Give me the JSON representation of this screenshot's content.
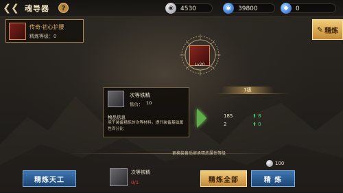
{
  "header": {
    "back_icon": "back-arrow-icon",
    "title": "魂导器",
    "help": "?"
  },
  "resources": {
    "silver": {
      "icon": "silver-coin-icon",
      "value": "4530"
    },
    "gold": {
      "icon": "gold-coin-icon",
      "value": "39800"
    },
    "diamond": {
      "icon": "diamond-icon",
      "value": "0"
    }
  },
  "tab": {
    "label": "精炼",
    "icon": "hammer-icon"
  },
  "equipment": {
    "name": "传奇·初心护腰",
    "refine_level": "精炼等级：0"
  },
  "center_item": {
    "level": "Lv20"
  },
  "level_banner": "1级",
  "stats": {
    "row1": {
      "value": "185",
      "increase": "8"
    },
    "row2": {
      "value": "2",
      "increase": "0"
    }
  },
  "tooltip": {
    "name": "次等铁精",
    "price_label": "售价：",
    "price_value": "10",
    "info_title": "物品信息",
    "description": "用于装备精炼的次等材料，提升装备基础属性百分比"
  },
  "hint": "更换装备后继承精炼属性等级",
  "material": {
    "name": "次等铁精",
    "count": "0/1"
  },
  "cost": {
    "value": "100"
  },
  "buttons": {
    "advanced": "精炼天工",
    "refine_all": "精炼全部",
    "refine": "精 炼"
  },
  "colors": {
    "gold_button": "#f2ce7b",
    "blue_button": "#3f77b2",
    "increase_green": "#53d36b",
    "count_red": "#e04040"
  }
}
